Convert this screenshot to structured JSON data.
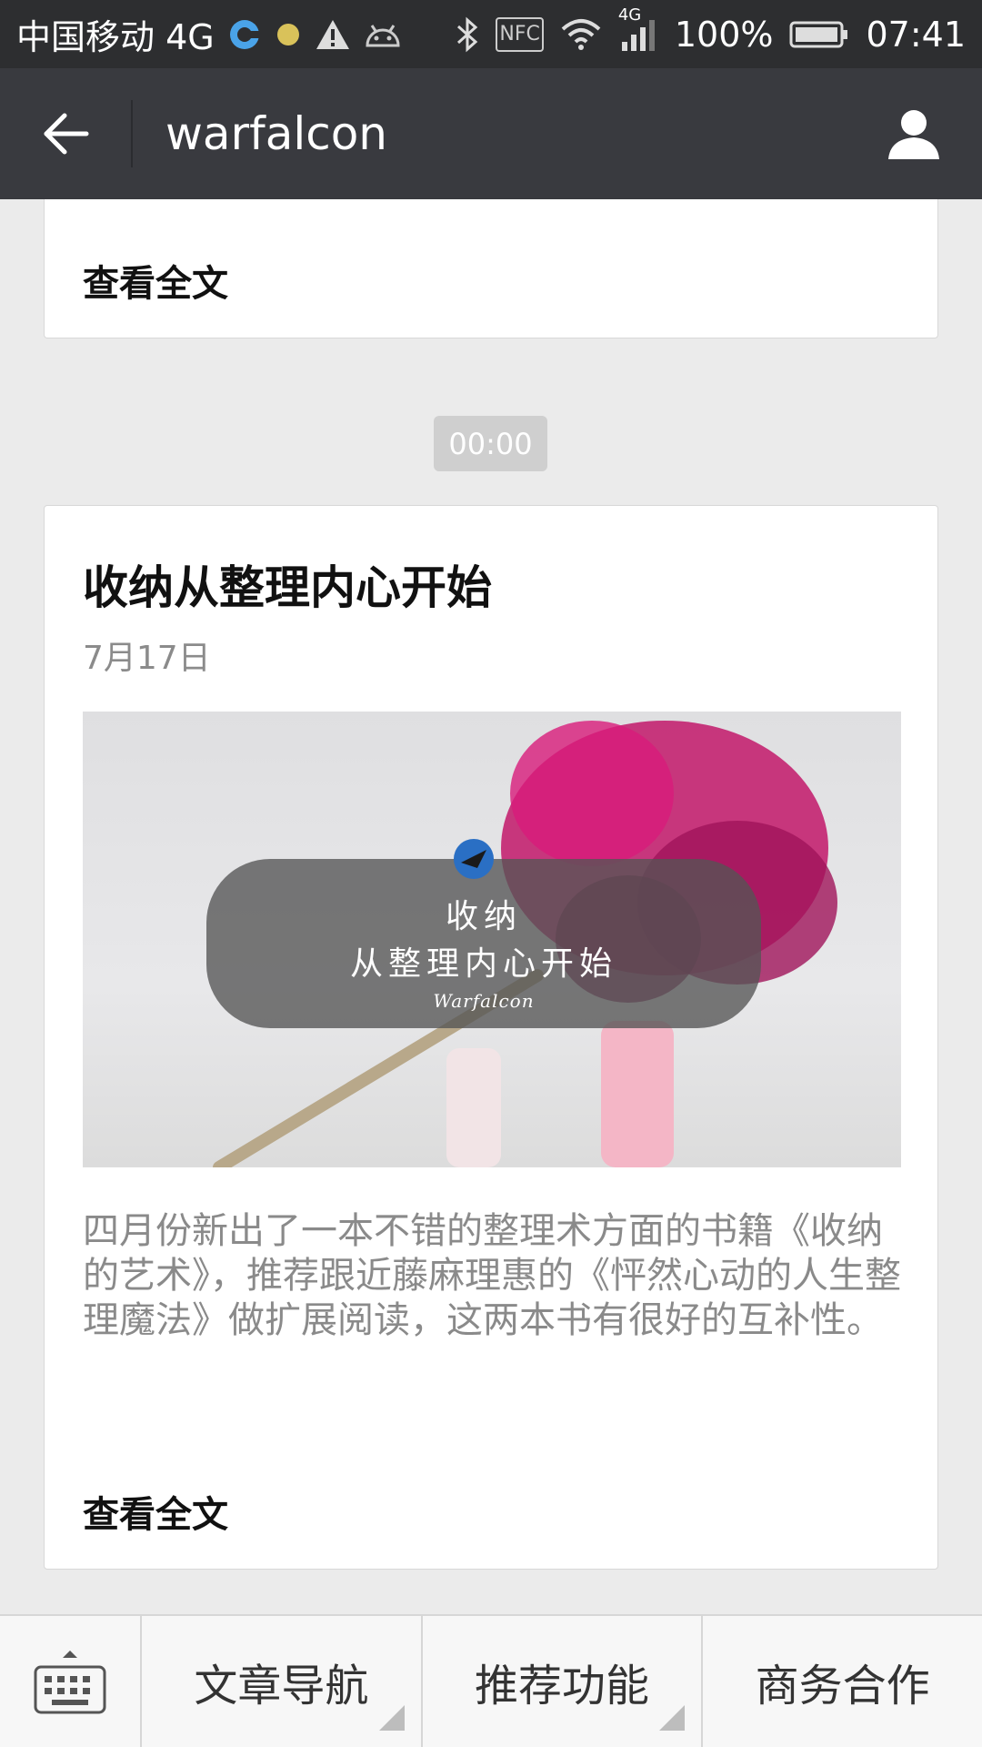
{
  "status_bar": {
    "carrier": "中国移动 4G",
    "net_label": "4G",
    "nfc_label": "NFC",
    "battery": "100%",
    "time": "07:41"
  },
  "app_bar": {
    "title": "warfalcon",
    "back_icon": "back-arrow-icon",
    "profile_icon": "person-icon"
  },
  "feed": {
    "previous_card": {
      "read_more": "查看全文"
    },
    "timestamp": "00:00",
    "article": {
      "title": "收纳从整理内心开始",
      "date": "7月17日",
      "cover": {
        "line1": "收纳",
        "line2": "从整理内心开始",
        "brand": "Warfalcon"
      },
      "summary": "四月份新出了一本不错的整理术方面的书籍《收纳的艺术》，推荐跟近藤麻理惠的《怦然心动的人生整理魔法》做扩展阅读，这两本书有很好的互补性。",
      "read_more": "查看全文"
    }
  },
  "bottom_menu": {
    "keyboard_icon": "keyboard-icon",
    "items": [
      {
        "label": "文章导航"
      },
      {
        "label": "推荐功能"
      },
      {
        "label": "商务合作"
      }
    ]
  }
}
